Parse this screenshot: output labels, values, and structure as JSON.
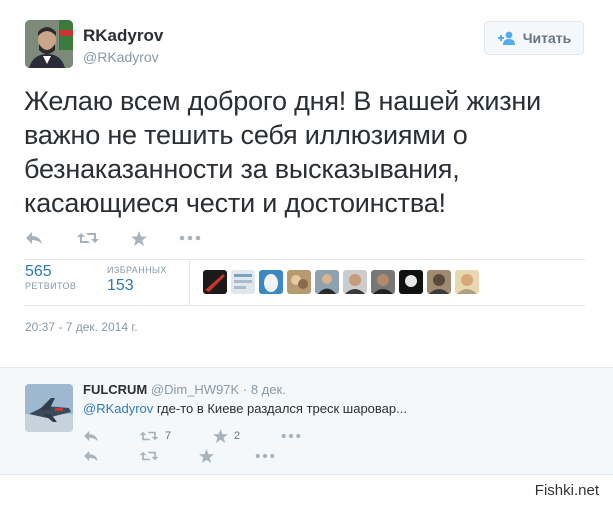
{
  "tweet": {
    "author_name": "RKadyrov",
    "author_handle": "@RKadyrov",
    "follow_label": "Читать",
    "text": "Желаю всем доброго дня! В нашей жизни важно не тешить себя иллюзиями о безнаказанности за высказывания, касающиеся чести и достоинства!",
    "retweets_count": "565",
    "retweets_label": "РЕТВИТОВ",
    "favorites_count": "153",
    "favorites_label": "ИЗБРАННЫХ",
    "timestamp": "20:37 - 7 дек. 2014 г."
  },
  "reply": {
    "author_name": "FULCRUM",
    "author_handle": "@Dim_HW97K",
    "separator": "·",
    "date": "8 дек.",
    "mention": "@RKadyrov",
    "text": " где-то в Киеве раздался треск шаровар...",
    "retweet_count": "7",
    "favorite_count": "2"
  },
  "watermark": "Fishki.net",
  "colors": {
    "link": "#2b7bb9",
    "muted": "#8899a6",
    "icon": "#a8b3bb",
    "reply_bg": "#f5f8fa"
  },
  "icons": [
    "reply-icon",
    "retweet-icon",
    "favorite-icon",
    "more-icon",
    "follow-person-icon"
  ]
}
